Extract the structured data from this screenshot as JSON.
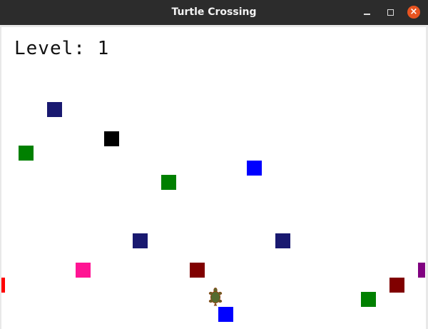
{
  "window": {
    "title": "Turtle Crossing",
    "controls": [
      "minimize-icon",
      "maximize-icon",
      "close-icon"
    ],
    "close_color": "#e95420"
  },
  "game": {
    "level_text": "Level: 1",
    "player": {
      "shape": "turtle",
      "color": "#556b2f",
      "outline": "#8b4513"
    },
    "cars": [
      {
        "color": "#191970"
      },
      {
        "color": "#000000"
      },
      {
        "color": "#008000"
      },
      {
        "color": "#0000ff"
      },
      {
        "color": "#008000"
      },
      {
        "color": "#191970"
      },
      {
        "color": "#191970"
      },
      {
        "color": "#ff1493"
      },
      {
        "color": "#800000"
      },
      {
        "color": "#800080"
      },
      {
        "color": "#ff0000"
      },
      {
        "color": "#800000"
      },
      {
        "color": "#008000"
      },
      {
        "color": "#0000ff"
      }
    ]
  }
}
